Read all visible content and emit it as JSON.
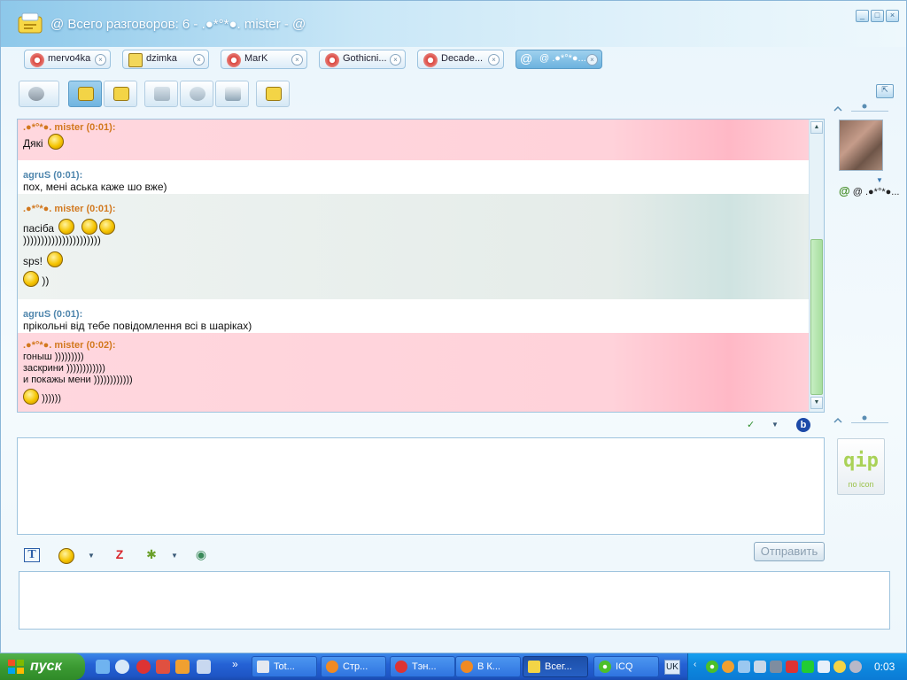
{
  "window": {
    "title": "@ Всего разговоров: 6 - .●*°*●. mister - @",
    "controls": [
      "minimize",
      "maximize",
      "close"
    ]
  },
  "tabs": [
    {
      "label": "mervo4ka",
      "icon": "flower-icon",
      "active": false
    },
    {
      "label": "dzimka",
      "icon": "na-status-icon",
      "active": false
    },
    {
      "label": "MarK",
      "icon": "flower-icon",
      "active": false
    },
    {
      "label": "Gothicni...",
      "icon": "flower-icon",
      "active": false
    },
    {
      "label": "Decade...",
      "icon": "flower-icon",
      "active": false
    },
    {
      "label": "@ .●*°*●....",
      "icon": "at-icon",
      "active": true
    }
  ],
  "messages": [
    {
      "nick": ".●*°*●. mister (0:01):",
      "sender": "mister",
      "lines": [
        "Дякі"
      ],
      "style": "pink"
    },
    {
      "nick": "agruS (0:01):",
      "sender": "agruS",
      "lines": [
        "пох, мені аська каже шо вже)"
      ],
      "style": "white"
    },
    {
      "nick": ".●*°*●. mister (0:01):",
      "sender": "mister",
      "lines": [
        "пасіба",
        "))))))))))))))))))))))",
        "sps!",
        "))"
      ],
      "style": "green"
    },
    {
      "nick": "agruS (0:01):",
      "sender": "agruS",
      "lines": [
        "прікольні від тебе повідомлення всі в шаріках)"
      ],
      "style": "white"
    },
    {
      "nick": ".●*°*●. mister (0:02):",
      "sender": "mister",
      "lines": [
        "гоныш )))))))))",
        "заскрини ))))))))))))",
        "и покажы мени ))))))))))))",
        "))))))"
      ],
      "style": "pink"
    }
  ],
  "contact": {
    "nick": "@ .●*°*●..."
  },
  "qip_logo": {
    "text": "qip",
    "sub": "no icon"
  },
  "send_button": {
    "label": "Отправить"
  },
  "taskbar": {
    "start_label": "пуск",
    "buttons": [
      {
        "label": "Tot...",
        "icon": "floppy-icon"
      },
      {
        "label": "Стр...",
        "icon": "firefox-icon"
      },
      {
        "label": "Тэн...",
        "icon": "opera-icon"
      },
      {
        "label": "В К...",
        "icon": "firefox-icon"
      },
      {
        "label": "Всег...",
        "icon": "qip-chat-icon",
        "active": true
      },
      {
        "label": "ICQ",
        "icon": "icq-flower-icon"
      }
    ],
    "lang": "UK",
    "clock": "0:03"
  }
}
